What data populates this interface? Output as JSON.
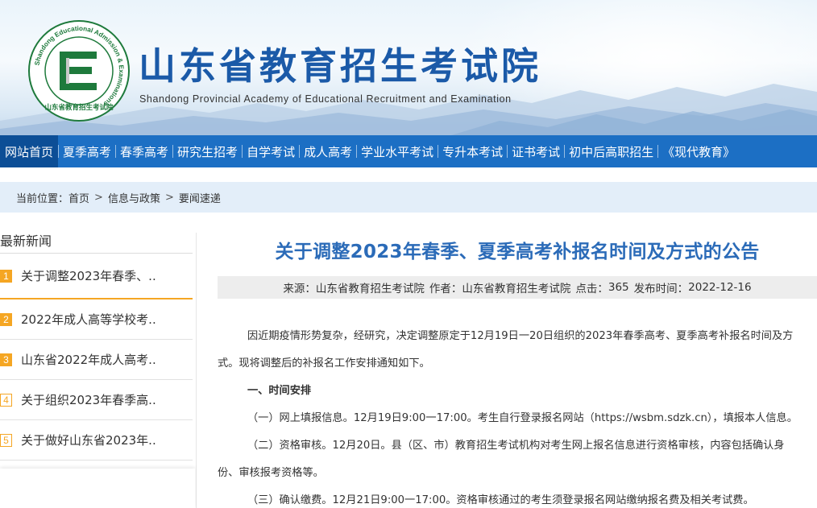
{
  "header": {
    "title_cn": "山东省教育招生考试院",
    "title_en": "Shandong Provincial Academy of Educational Recruitment and Examination",
    "seal_ring_text": "Shandong Educational Admission & Examinations",
    "seal_bottom_text": "山东省教育招生考试院",
    "seal_letter": "E"
  },
  "nav": {
    "items": [
      "网站首页",
      "夏季高考",
      "春季高考",
      "研究生招考",
      "自学考试",
      "成人高考",
      "学业水平考试",
      "专升本考试",
      "证书考试",
      "初中后高职招生",
      "《现代教育》"
    ]
  },
  "breadcrumb": {
    "label": "当前位置：",
    "items": [
      "首页",
      "信息与政策",
      "要闻速递"
    ],
    "separator": ">"
  },
  "sidebar": {
    "title": "最新新闻",
    "items": [
      {
        "num": "1",
        "text": "关于调整2023年春季、.."
      },
      {
        "num": "2",
        "text": "2022年成人高等学校考.."
      },
      {
        "num": "3",
        "text": "山东省2022年成人高考.."
      },
      {
        "num": "4",
        "text": "关于组织2023年春季高.."
      },
      {
        "num": "5",
        "text": "关于做好山东省2023年.."
      }
    ]
  },
  "article": {
    "title": "关于调整2023年春季、夏季高考补报名时间及方式的公告",
    "meta": {
      "source_label": "来源：",
      "source": "山东省教育招生考试院",
      "author_label": "作者：",
      "author": "山东省教育招生考试院",
      "clicks_label": "点击：",
      "clicks": "365",
      "date_label": "发布时间：",
      "date": "2022-12-16"
    },
    "paragraphs": {
      "p1_line1": "因近期疫情形势复杂，经研究，决定调整原定于12月19日一20日组织的2023年春季高考、夏季高考补报名时间及方",
      "p1_line2": "式。现将调整后的补报名工作安排通知如下。",
      "heading1": "一、时间安排",
      "item1": "（一）网上填报信息。12月19日9:00一17:00。考生自行登录报名网站（https://wsbm.sdzk.cn），填报本人信息。",
      "item2_line1": "（二）资格审核。12月20日。县（区、市）教育招生考试机构对考生网上报名信息进行资格审核，内容包括确认身",
      "item2_line2": "份、审核报考资格等。",
      "item3": "（三）确认缴费。12月21日9:00一17:00。资格审核通过的考生须登录报名网站缴纳报名费及相关考试费。"
    }
  },
  "colors": {
    "nav_bg": "#1c6fc4",
    "nav_active_bg": "#0c4e96",
    "title_blue": "#1b5aa8",
    "article_title": "#2b6bb8",
    "accent_orange": "#f5a623",
    "seal_green": "#1e7a3c"
  }
}
